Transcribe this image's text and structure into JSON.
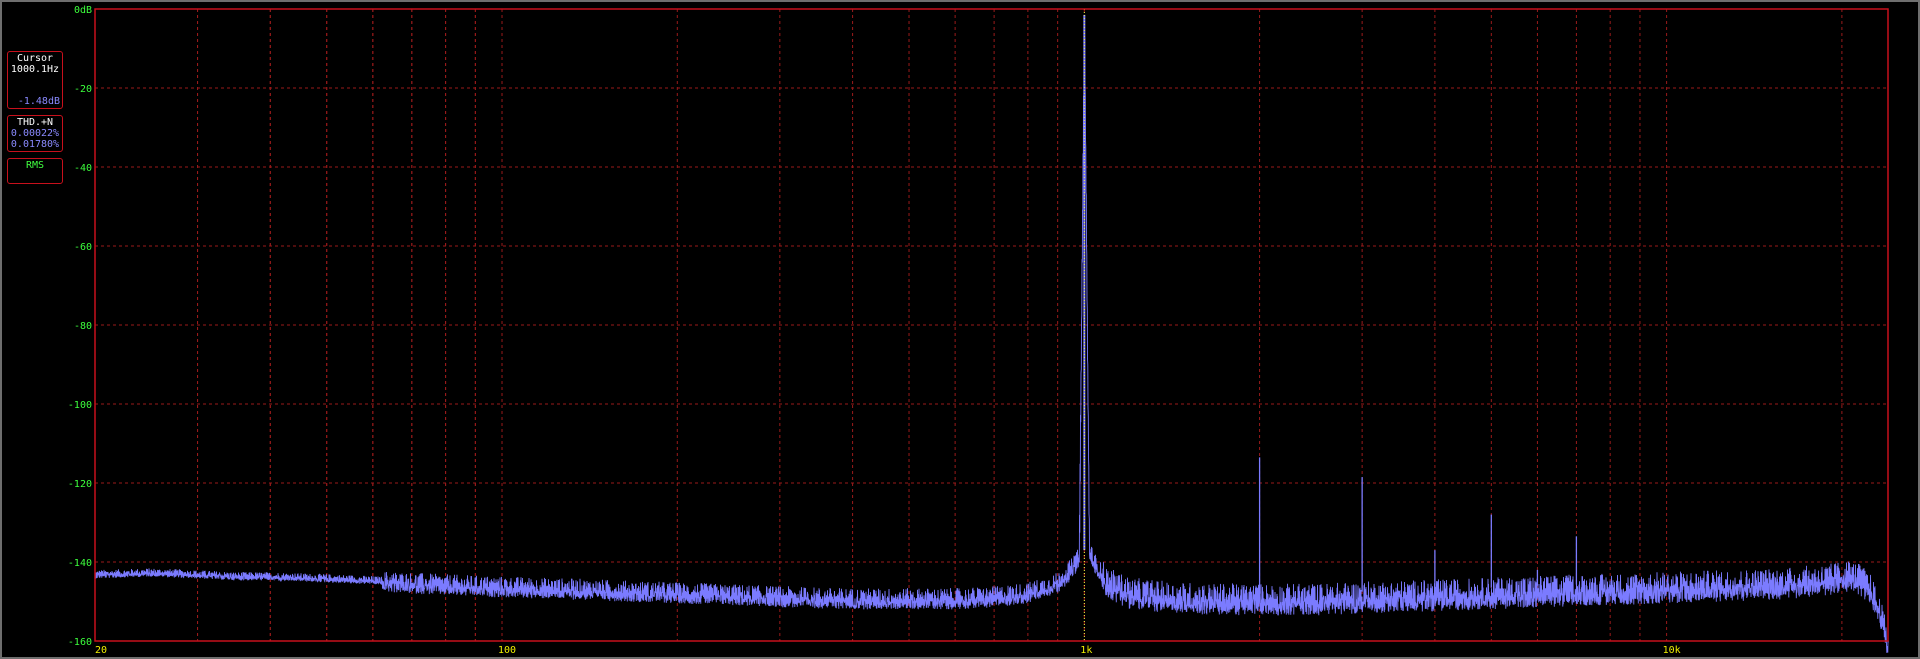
{
  "cursor_panel": {
    "title": "Cursor",
    "frequency": "1000.1Hz",
    "level": "-1.48dB"
  },
  "thd_panel": {
    "title": "THD.+N",
    "thd": "0.00022%",
    "thd_n": "0.01780%"
  },
  "rms_panel": {
    "title": "RMS"
  },
  "colors": {
    "background": "#000000",
    "frame": "#c8101c",
    "grid": "#9a1a1a",
    "trace": "#7b7bff",
    "y_ticks": "#3cff3c",
    "x_ticks": "#f0f000",
    "cursor_line": "#ffff40"
  },
  "chart_data": {
    "type": "line",
    "x_scale": "log",
    "xlim": [
      20,
      24000
    ],
    "ylim": [
      -160,
      0
    ],
    "grid": true,
    "cursor_x": 1000.1,
    "y_tick_labels": [
      {
        "value": 0,
        "label": "0dB"
      },
      {
        "value": -20,
        "label": "-20"
      },
      {
        "value": -40,
        "label": "-40"
      },
      {
        "value": -60,
        "label": "-60"
      },
      {
        "value": -80,
        "label": "-80"
      },
      {
        "value": -100,
        "label": "-100"
      },
      {
        "value": -120,
        "label": "-120"
      },
      {
        "value": -140,
        "label": "-140"
      },
      {
        "value": -160,
        "label": "-160"
      }
    ],
    "x_tick_labels": [
      {
        "value": 20,
        "label": "20"
      },
      {
        "value": 100,
        "label": "100"
      },
      {
        "value": 1000,
        "label": "1k"
      },
      {
        "value": 10000,
        "label": "10k"
      }
    ],
    "series": [
      {
        "x": [
          20,
          25,
          30,
          35,
          40,
          50,
          60,
          70,
          80,
          100,
          130,
          160,
          200,
          250,
          300,
          400,
          500,
          600,
          700,
          800,
          900,
          950,
          980,
          1000.1,
          1020,
          1050,
          1100,
          1200,
          1400,
          1700,
          2000,
          2500,
          3000,
          4000,
          5000,
          6000,
          8000,
          10000,
          13000,
          16000,
          19000,
          20500,
          21500,
          22500,
          23300,
          24000
        ],
        "values": [
          -143,
          -142.5,
          -143,
          -143.5,
          -143.5,
          -144,
          -144.5,
          -145,
          -145.5,
          -146,
          -146.5,
          -147,
          -147.5,
          -148,
          -148.5,
          -149,
          -149,
          -149,
          -148.5,
          -147.5,
          -145,
          -141.5,
          -138.5,
          -1.48,
          -137,
          -141,
          -145,
          -147.5,
          -148.5,
          -149,
          -149,
          -149,
          -148.5,
          -148,
          -147.5,
          -147,
          -146.5,
          -146,
          -145.5,
          -145,
          -144,
          -143,
          -144,
          -147,
          -153,
          -160
        ]
      }
    ],
    "harmonics": [
      {
        "x": 2000,
        "y": -113.5
      },
      {
        "x": 3000,
        "y": -118.5
      },
      {
        "x": 4000,
        "y": -137
      },
      {
        "x": 5000,
        "y": -128
      },
      {
        "x": 6000,
        "y": -142
      },
      {
        "x": 7000,
        "y": -133.5
      }
    ]
  }
}
